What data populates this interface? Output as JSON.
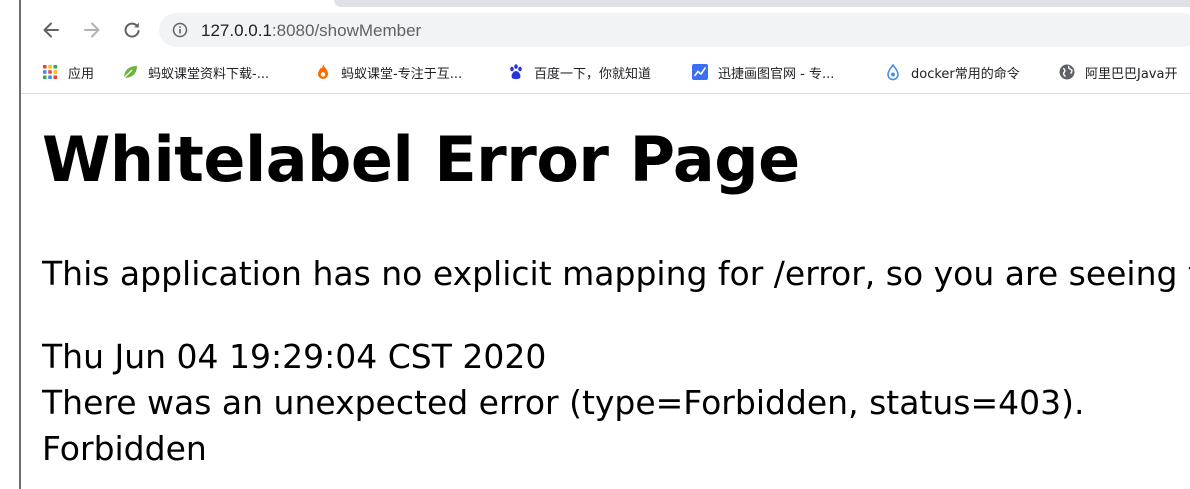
{
  "browser": {
    "url_host": "127.0.0.1",
    "url_rest": ":8080/showMember",
    "bookmarks": [
      {
        "label": "应用",
        "icon": "apps-grid-icon"
      },
      {
        "label": "蚂蚁课堂资料下载-...",
        "icon": "leaf-icon"
      },
      {
        "label": "蚂蚁课堂-专注于互...",
        "icon": "flame-icon"
      },
      {
        "label": "百度一下，你就知道",
        "icon": "baidu-paw-icon"
      },
      {
        "label": "迅捷画图官网 - 专...",
        "icon": "chart-icon"
      },
      {
        "label": "docker常用的命令",
        "icon": "drop-icon"
      },
      {
        "label": "阿里巴巴Java开",
        "icon": "globe-icon"
      }
    ]
  },
  "page": {
    "title": "Whitelabel Error Page",
    "message": "This application has no explicit mapping for /error, so you are seeing this as a fallback.",
    "timestamp": "Thu Jun 04 19:29:04 CST 2020",
    "error_line": "There was an unexpected error (type=Forbidden, status=403).",
    "error_reason": "Forbidden"
  },
  "colors": {
    "toolbar_icon": "#5f6368",
    "omnibox_bg": "#f1f3f4"
  }
}
